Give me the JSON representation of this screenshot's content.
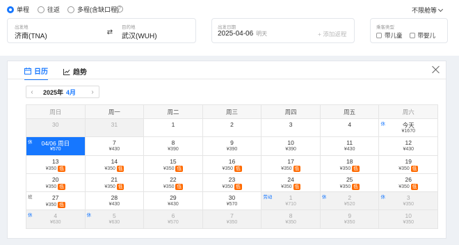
{
  "trip_types": [
    {
      "label": "单程",
      "selected": true
    },
    {
      "label": "往返",
      "selected": false
    },
    {
      "label": "多程(含缺口程)",
      "selected": false
    }
  ],
  "help_glyph": "?",
  "cabin": "不限舱等",
  "search": {
    "from_label": "出发地",
    "from_value": "济南(TNA)",
    "to_label": "目的地",
    "to_value": "武汉(WUH)",
    "date_label": "出发日期",
    "date_value": "2025-04-06",
    "date_hint": "明天",
    "add_return": "+ 添加返程",
    "pax_label": "乘客类型",
    "pax_child": "带儿童",
    "pax_infant": "带婴儿"
  },
  "calendar": {
    "tabs": [
      {
        "label": "日历",
        "icon": "calendar-icon",
        "active": true
      },
      {
        "label": "趋势",
        "icon": "trend-chart-icon",
        "active": false
      }
    ],
    "prev_arrow": "‹",
    "next_arrow": "›",
    "year": "2025年",
    "month": "4月",
    "weekdays": [
      "周日",
      "周一",
      "周二",
      "周三",
      "周四",
      "周五",
      "周六"
    ],
    "low_badge": "低",
    "weeks": [
      [
        {
          "d": "30",
          "p": "",
          "state": "dis"
        },
        {
          "d": "31",
          "p": "",
          "state": "dis"
        },
        {
          "d": "1",
          "p": ""
        },
        {
          "d": "2",
          "p": ""
        },
        {
          "d": "3",
          "p": ""
        },
        {
          "d": "4",
          "p": ""
        },
        {
          "d": "今天",
          "p": "¥1670",
          "tag": "休"
        }
      ],
      [
        {
          "d": "04/06 周日",
          "p": "¥570",
          "state": "sel",
          "tag": "休"
        },
        {
          "d": "7",
          "p": "¥430"
        },
        {
          "d": "8",
          "p": "¥390"
        },
        {
          "d": "9",
          "p": "¥390"
        },
        {
          "d": "10",
          "p": "¥390"
        },
        {
          "d": "11",
          "p": "¥430"
        },
        {
          "d": "12",
          "p": "¥430"
        }
      ],
      [
        {
          "d": "13",
          "p": "¥350",
          "low": true
        },
        {
          "d": "14",
          "p": "¥350",
          "low": true
        },
        {
          "d": "15",
          "p": "¥350",
          "low": true
        },
        {
          "d": "16",
          "p": "¥350",
          "low": true
        },
        {
          "d": "17",
          "p": "¥350",
          "low": true
        },
        {
          "d": "18",
          "p": "¥350",
          "low": true
        },
        {
          "d": "19",
          "p": "¥350",
          "low": true
        }
      ],
      [
        {
          "d": "20",
          "p": "¥350",
          "low": true
        },
        {
          "d": "21",
          "p": "¥350",
          "low": true
        },
        {
          "d": "22",
          "p": "¥350",
          "low": true
        },
        {
          "d": "23",
          "p": "¥350",
          "low": true
        },
        {
          "d": "24",
          "p": "¥350",
          "low": true
        },
        {
          "d": "25",
          "p": "¥350",
          "low": true
        },
        {
          "d": "26",
          "p": "¥350",
          "low": true
        }
      ],
      [
        {
          "d": "27",
          "p": "¥350",
          "low": true,
          "tag": "班",
          "tagtype": "ban"
        },
        {
          "d": "28",
          "p": "¥430"
        },
        {
          "d": "29",
          "p": "¥430"
        },
        {
          "d": "30",
          "p": "¥570"
        },
        {
          "d": "1",
          "p": "¥710",
          "state": "dis",
          "tag": "劳动"
        },
        {
          "d": "2",
          "p": "¥520",
          "state": "dis",
          "tag": "休"
        },
        {
          "d": "3",
          "p": "¥350",
          "state": "dis",
          "tag": "休"
        }
      ],
      [
        {
          "d": "4",
          "p": "¥630",
          "state": "dis",
          "tag": "休"
        },
        {
          "d": "5",
          "p": "¥630",
          "state": "dis",
          "tag": "休"
        },
        {
          "d": "6",
          "p": "¥570",
          "state": "dis"
        },
        {
          "d": "7",
          "p": "¥350",
          "state": "dis"
        },
        {
          "d": "8",
          "p": "¥350",
          "state": "dis"
        },
        {
          "d": "9",
          "p": "¥350",
          "state": "dis"
        },
        {
          "d": "10",
          "p": "¥350",
          "state": "dis"
        }
      ]
    ]
  },
  "colors": {
    "accent": "#1677ff",
    "low_badge": "#ff6a00"
  }
}
